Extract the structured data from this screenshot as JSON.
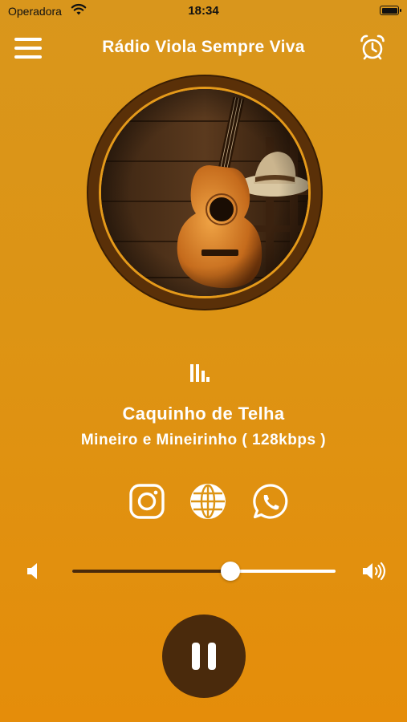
{
  "status_bar": {
    "carrier": "Operadora",
    "time": "18:34",
    "battery_level": 1.0
  },
  "header": {
    "title": "Rádio Viola Sempre Viva",
    "menu_icon": "menu-icon",
    "alarm_icon": "alarm-clock-icon"
  },
  "artwork": {
    "description_icon": "album-art"
  },
  "now_playing": {
    "song": "Caquinho de Telha",
    "artist_info": "Mineiro e Mineirinho ( 128kbps )",
    "equalizer_icon": "equalizer-icon"
  },
  "social": [
    {
      "name": "instagram-icon"
    },
    {
      "name": "globe-icon"
    },
    {
      "name": "whatsapp-icon"
    }
  ],
  "volume": {
    "level": 0.6,
    "low_icon": "volume-low-icon",
    "high_icon": "volume-high-icon"
  },
  "player": {
    "state_icon": "pause-icon"
  },
  "colors": {
    "background": "#dd9414",
    "accent_dark": "#4a2a0c",
    "foreground": "#ffffff"
  }
}
